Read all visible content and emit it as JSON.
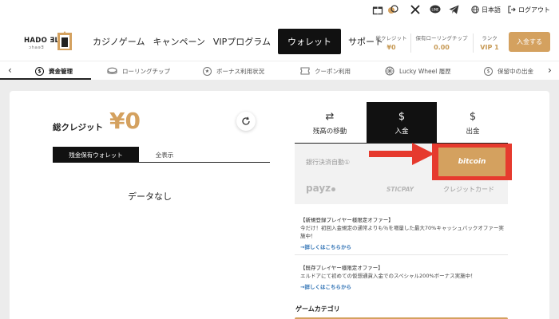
{
  "util": {
    "language": "日本語",
    "logout": "ログアウト"
  },
  "logo": {
    "text": "HADO ƎL",
    "sub": "ɔhaɘƎ"
  },
  "nav": {
    "items": [
      "カジノゲーム",
      "キャンペーン",
      "VIPプログラム",
      "ウォレット",
      "サポート"
    ]
  },
  "stats": {
    "credit_label": "総クレジット",
    "credit_value": "¥0",
    "rolling_label": "保有ローリングチップ",
    "rolling_value": "0.00",
    "rank_label": "ランク",
    "rank_value": "VIP 1"
  },
  "deposit_button": "入金する",
  "subnav": {
    "items": [
      {
        "label": "資金管理",
        "icon": "dollar-icon"
      },
      {
        "label": "ローリングチップ",
        "icon": "chip-icon"
      },
      {
        "label": "ボーナス利用状況",
        "icon": "star-icon"
      },
      {
        "label": "クーポン利用",
        "icon": "ticket-icon"
      },
      {
        "label": "Lucky Wheel 履歴",
        "icon": "wheel-icon"
      },
      {
        "label": "保留中の出金",
        "icon": "dollar-icon"
      }
    ]
  },
  "wallet": {
    "credit_label": "総クレジット",
    "credit_value": "¥0",
    "tab_active": "残金保有ウォレット",
    "tab_inactive": "全表示",
    "empty": "データなし"
  },
  "right_tabs": [
    {
      "label": "残高の移動",
      "icon": "⇄"
    },
    {
      "label": "入金",
      "icon": "$"
    },
    {
      "label": "出金",
      "icon": "$"
    }
  ],
  "payment": {
    "bank": "銀行決済自動①",
    "bitcoin": "bitcoin",
    "payz": "payz",
    "sticpay": "STICPAY",
    "credit_card": "クレジットカード"
  },
  "promos": [
    {
      "title": "【新規登録プレイヤー様限定オファー】",
      "body": "今だけ！初回入金規定の通常よりも％を増量した最大70%キャッシュバックオファー実施中！",
      "link": "→詳しくはこちらから"
    },
    {
      "title": "【既存プレイヤー様限定オファー】",
      "body": "エルドアにて初めての仮想通貨入金でのスペシャル200%ボーナス実施中！",
      "link": "→詳しくはこちらから"
    }
  ],
  "game_category": "ゲームカテゴリ",
  "colors": {
    "gold": "#d4a15f",
    "highlight_red": "#e63a2e"
  }
}
